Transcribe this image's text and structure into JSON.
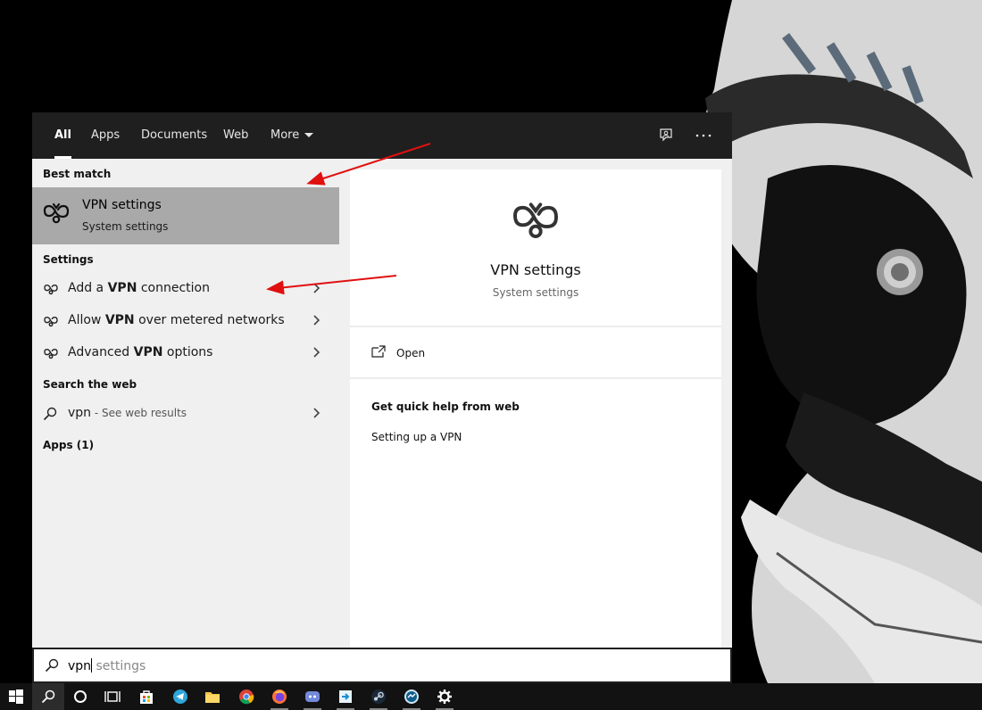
{
  "search_panel": {
    "tabs": [
      {
        "label": "All",
        "active": true
      },
      {
        "label": "Apps"
      },
      {
        "label": "Documents"
      },
      {
        "label": "Web"
      },
      {
        "label": "More"
      }
    ],
    "toolbar_icons": [
      "feedback-icon",
      "more-options-icon"
    ],
    "best_match": {
      "section_label": "Best match",
      "title": "VPN settings",
      "subtitle": "System settings",
      "icon": "vpn-icon"
    },
    "settings": {
      "section_label": "Settings",
      "items": [
        {
          "prefix": "Add a ",
          "bold": "VPN",
          "suffix": " connection",
          "icon": "vpn-icon"
        },
        {
          "prefix": "Allow ",
          "bold": "VPN",
          "suffix": " over metered networks",
          "icon": "vpn-icon"
        },
        {
          "prefix": "Advanced ",
          "bold": "VPN",
          "suffix": " options",
          "icon": "vpn-icon"
        }
      ]
    },
    "web": {
      "section_label": "Search the web",
      "query": "vpn",
      "hint": " - See web results",
      "icon": "search-icon"
    },
    "apps_label": "Apps (1)",
    "preview": {
      "title": "VPN settings",
      "subtitle": "System settings",
      "open_label": "Open",
      "help_title": "Get quick help from web",
      "help_links": [
        "Setting up a VPN"
      ]
    },
    "search_box": {
      "typed": "vpn",
      "suggestion": " settings"
    }
  },
  "taskbar": {
    "items": [
      "windows-start-icon",
      "search-icon",
      "cortana-icon",
      "task-view-icon",
      "store-icon",
      "telegram-icon",
      "file-explorer-icon",
      "chrome-icon",
      "firefox-icon",
      "discord-icon",
      "remote-app-icon",
      "steam-icon",
      "messenger-icon",
      "settings-gear-icon"
    ]
  },
  "colors": {
    "tabbar_bg": "#1f1f1f",
    "left_bg": "#f0f0f0",
    "selected_bg": "#a9a9a9",
    "annotation_arrow": "#e01010"
  }
}
